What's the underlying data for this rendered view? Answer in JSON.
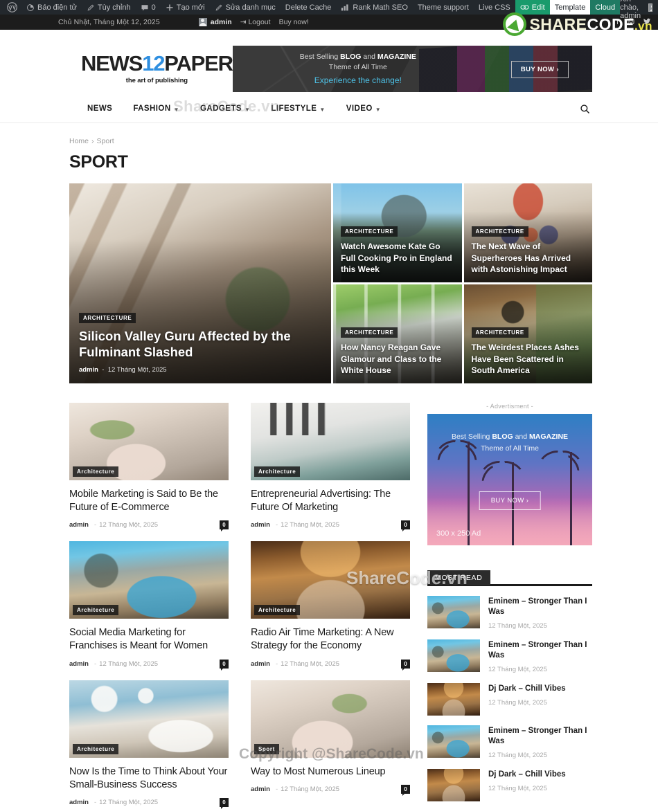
{
  "adminbar": {
    "items": [
      {
        "label": "",
        "icon": "wordpress-logo-icon"
      },
      {
        "label": "Báo điện tử",
        "icon": "dashboard-icon"
      },
      {
        "label": "Tùy chỉnh",
        "icon": "customize-brush-icon"
      },
      {
        "label": "0",
        "icon": "comment-bubble-icon"
      },
      {
        "label": "Tạo mới",
        "icon": "plus-icon"
      },
      {
        "label": "Sửa danh mục",
        "icon": "pencil-edit-icon"
      },
      {
        "label": "Delete Cache",
        "icon": ""
      },
      {
        "label": "Rank Math SEO",
        "icon": "rank-math-bars-icon"
      },
      {
        "label": "Theme support",
        "icon": ""
      },
      {
        "label": "Live CSS",
        "icon": ""
      }
    ],
    "edit": "Edit",
    "template": "Template",
    "cloud": "Cloud",
    "greeting": "Xin chào, admin",
    "colors": {
      "bar": "#23282d",
      "edit": "#1a9b6c",
      "cloud": "#1f7a63"
    }
  },
  "topbar": {
    "date": "Chủ Nhật, Tháng Một 12, 2025",
    "user": "admin",
    "logout": "Logout",
    "buy": "Buy now!",
    "socials": [
      "facebook-icon",
      "instagram-icon",
      "twitter-icon"
    ]
  },
  "watermark": {
    "brand_share": "SHARE",
    "brand_code": "CODE",
    "brand_vn": ".vn",
    "overlay_text": "ShareCode.vn",
    "copyright": "Copyright @ShareCode.vn",
    "colors": {
      "green": "#4aa832",
      "yellow": "#e9e44b"
    }
  },
  "header": {
    "logo": {
      "part1": "NEWS",
      "part2": "12",
      "part3": "PAPER",
      "tagline": "the art of publishing",
      "accent": "#2f8fe0"
    },
    "ad": {
      "line1_a": "Best Selling ",
      "line1_b": "BLOG",
      "line1_c": " and ",
      "line1_d": "MAGAZINE",
      "line2": "Theme of All Time",
      "line3": "Experience the change!",
      "button": "BUY NOW  ›"
    }
  },
  "nav": {
    "items": [
      {
        "label": "NEWS",
        "has_dropdown": false
      },
      {
        "label": "FASHION",
        "has_dropdown": true
      },
      {
        "label": "GADGETS",
        "has_dropdown": true
      },
      {
        "label": "LIFESTYLE",
        "has_dropdown": true
      },
      {
        "label": "VIDEO",
        "has_dropdown": true
      }
    ],
    "search_icon": "search-icon"
  },
  "breadcrumb": {
    "home": "Home",
    "sep": "›",
    "current": "Sport"
  },
  "page_title": "SPORT",
  "hero": {
    "main": {
      "category": "ARCHITECTURE",
      "title": "Silicon Valley Guru Affected by the Fulminant Slashed",
      "author": "admin",
      "date": "12 Tháng Một, 2025",
      "photo": "p-loft"
    },
    "cells": [
      {
        "category": "ARCHITECTURE",
        "title": "Watch Awesome Kate Go Full Cooking Pro in England this Week",
        "photo": "p-lake"
      },
      {
        "category": "ARCHITECTURE",
        "title": "The Next Wave of Superheroes Has Arrived with Astonishing Impact",
        "photo": "p-bed1"
      },
      {
        "category": "ARCHITECTURE",
        "title": "How Nancy Reagan Gave Glamour and Class to the White House",
        "photo": "p-green"
      },
      {
        "category": "ARCHITECTURE",
        "title": "The Weirdest Places Ashes Have Been Scattered in South America",
        "photo": "p-porch"
      }
    ]
  },
  "cards": [
    {
      "category": "Architecture",
      "title": "Mobile Marketing is Said to Be the Future of E-Commerce",
      "author": "admin",
      "date": "12 Tháng Một, 2025",
      "comments": "0",
      "photo": "p-bath"
    },
    {
      "category": "Architecture",
      "title": "Entrepreneurial Advertising: The Future Of Marketing",
      "author": "admin",
      "date": "12 Tháng Một, 2025",
      "comments": "0",
      "photo": "p-bed2"
    },
    {
      "category": "Architecture",
      "title": "Social Media Marketing for Franchises is Meant for Women",
      "author": "admin",
      "date": "12 Tháng Một, 2025",
      "comments": "0",
      "photo": "p-pool"
    },
    {
      "category": "Architecture",
      "title": "Radio Air Time Marketing: A New Strategy for the Economy",
      "author": "admin",
      "date": "12 Tháng Một, 2025",
      "comments": "0",
      "photo": "p-lobby"
    },
    {
      "category": "Architecture",
      "title": "Now Is the Time to Think About Your Small-Business Success",
      "author": "admin",
      "date": "12 Tháng Một, 2025",
      "comments": "0",
      "photo": "p-blue"
    },
    {
      "category": "Sport",
      "title": "Way to Most Numerous Lineup",
      "author": "admin",
      "date": "12 Tháng Một, 2025",
      "comments": "0",
      "photo": "p-sport"
    }
  ],
  "sidebar": {
    "ad_label": "- Advertisment -",
    "ad": {
      "line1_a": "Best Selling ",
      "line1_b": "BLOG",
      "line1_c": " and ",
      "line1_d": "MAGAZINE",
      "line2": "Theme of All Time",
      "button": "BUY NOW  ›",
      "size": "300 x 250 Ad"
    },
    "widget_title": "MOST READ",
    "most_read": [
      {
        "title": "Eminem – Stronger Than I Was",
        "date": "12 Tháng Một, 2025",
        "photo": "p-pool"
      },
      {
        "title": "Eminem – Stronger Than I Was",
        "date": "12 Tháng Một, 2025",
        "photo": "p-pool"
      },
      {
        "title": "Dj Dark – Chill Vibes",
        "date": "12 Tháng Một, 2025",
        "photo": "p-lobby"
      },
      {
        "title": "Eminem – Stronger Than I Was",
        "date": "12 Tháng Một, 2025",
        "photo": "p-pool"
      },
      {
        "title": "Dj Dark – Chill Vibes",
        "date": "12 Tháng Một, 2025",
        "photo": "p-lobby"
      }
    ]
  }
}
